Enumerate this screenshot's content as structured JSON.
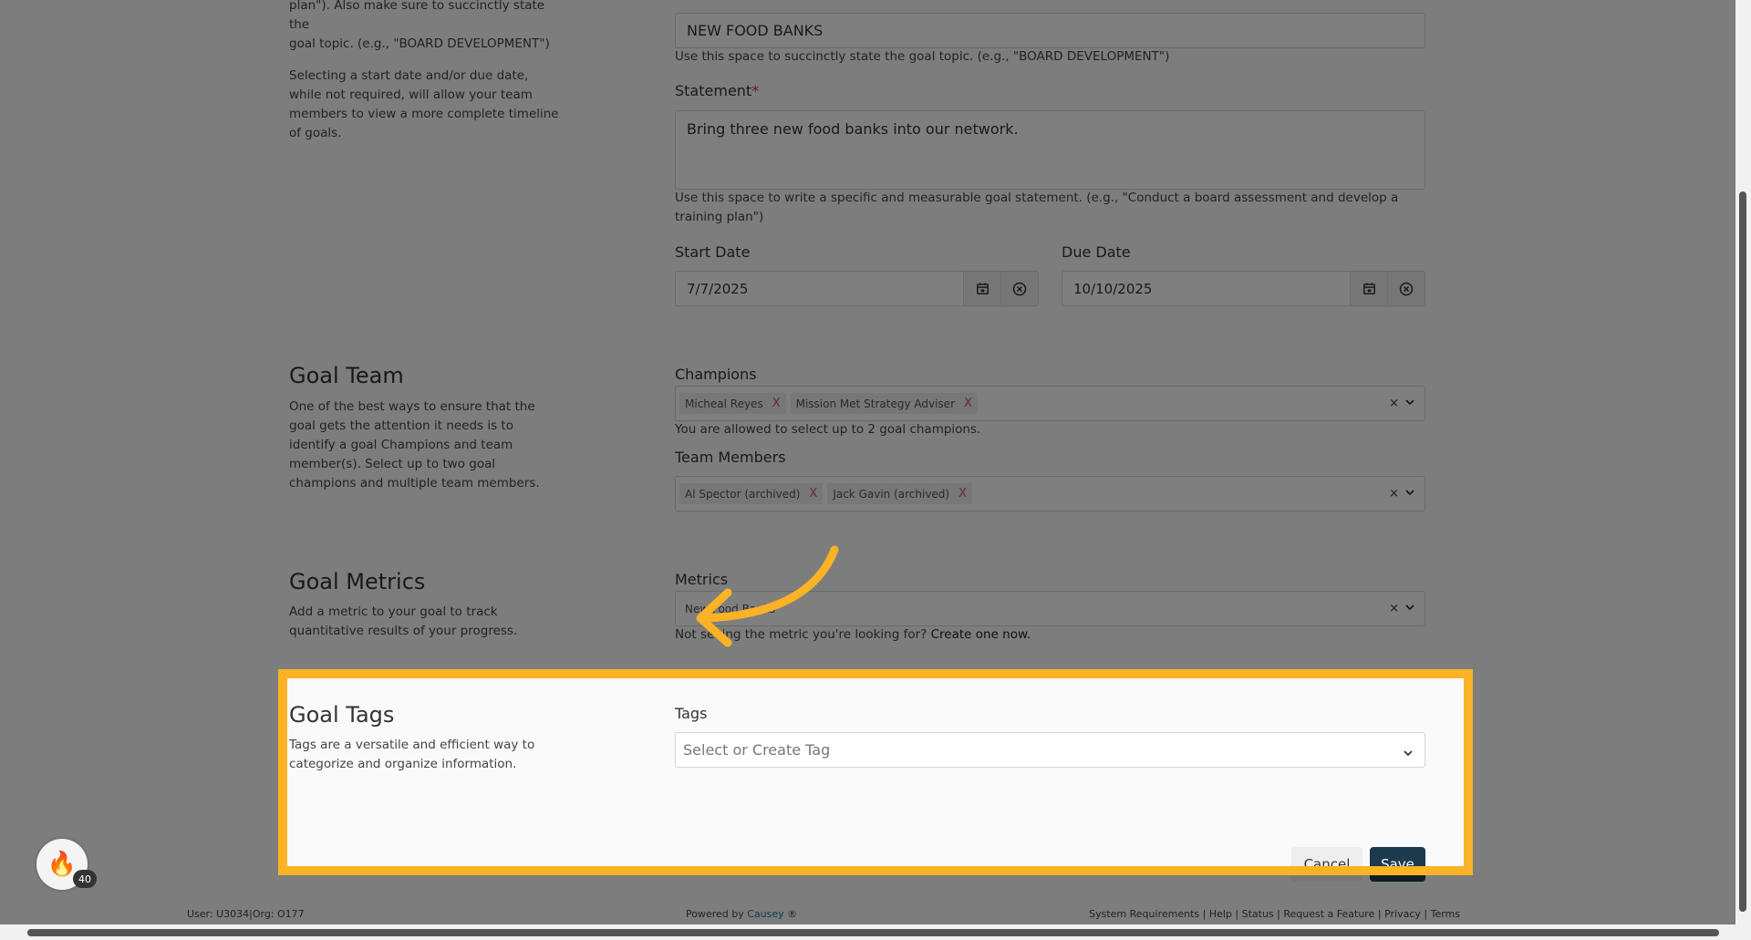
{
  "goal_info_help": {
    "line1": "plan\"). Also make sure to succinctly state the",
    "line2": "goal topic. (e.g., \"BOARD DEVELOPMENT\")",
    "dates_help": "Selecting a start date and/or due date, while not required, will allow your team members to view a more complete timeline of goals."
  },
  "topic": {
    "value": "NEW FOOD BANKS",
    "help": "Use this space to succinctly state the goal topic. (e.g., \"BOARD DEVELOPMENT\")"
  },
  "statement": {
    "label": "Statement",
    "required_mark": "*",
    "value": "Bring three new food banks into our network.",
    "help": "Use this space to write a specific and measurable goal statement. (e.g., \"Conduct a board assessment and develop a training plan\")"
  },
  "start_date": {
    "label": "Start Date",
    "value": "7/7/2025"
  },
  "due_date": {
    "label": "Due Date",
    "value": "10/10/2025"
  },
  "goal_team": {
    "title": "Goal Team",
    "description": "One of the best ways to ensure that the goal gets the attention it needs is to identify a goal Champions and team member(s). Select up to two goal champions and multiple team members.",
    "champions_label": "Champions",
    "champions": [
      "Micheal Reyes",
      "Mission Met Strategy Adviser"
    ],
    "champions_help": "You are allowed to select up to 2 goal champions.",
    "team_label": "Team Members",
    "team_members": [
      "Al Spector (archived)",
      "Jack Gavin (archived)"
    ]
  },
  "goal_metrics": {
    "title": "Goal Metrics",
    "description": "Add a metric to your goal to track quantitative results of your progress.",
    "label": "Metrics",
    "selected": "New Food Banks",
    "help_prefix": "Not seeing the metric you're looking for?",
    "help_link": "Create one now."
  },
  "goal_tags": {
    "title": "Goal Tags",
    "description": "Tags are a versatile and efficient way to categorize and organize information.",
    "label": "Tags",
    "placeholder": "Select or Create Tag"
  },
  "actions": {
    "cancel": "Cancel",
    "save": "Save"
  },
  "footer": {
    "user": "User: U3034|Org: O177",
    "powered_prefix": "Powered by",
    "powered_brand": "Causey",
    "powered_suffix": "®",
    "links": [
      "System Requirements",
      "Help",
      "Status",
      "Request a Feature",
      "Privacy",
      "Terms"
    ]
  },
  "notification_count": "40",
  "icons": {
    "clear": "×",
    "chevron": "⌄",
    "remove": "X",
    "calendar": "calendar-icon",
    "clear_date": "clear-circle-icon",
    "fire": "🔥"
  },
  "colors": {
    "highlight": "#fbb224",
    "save_button": "#1d3a4f",
    "link": "#1a7a9b"
  }
}
